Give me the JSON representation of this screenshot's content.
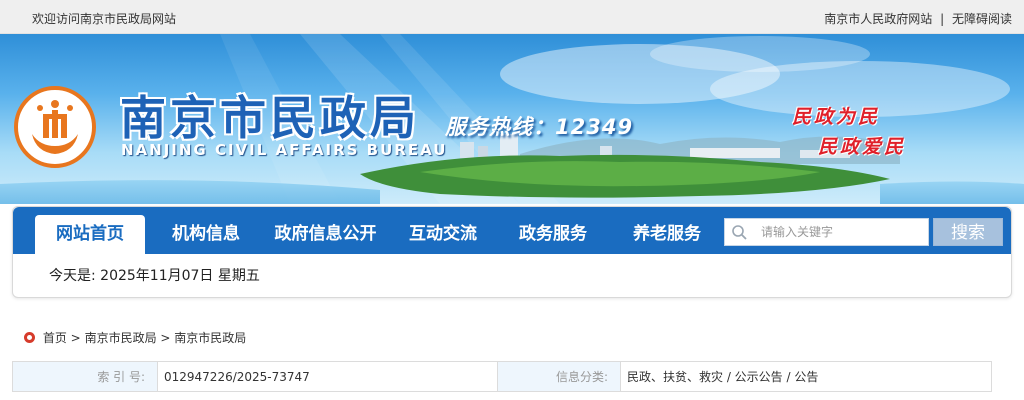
{
  "topbar": {
    "welcome": "欢迎访问南京市民政局网站",
    "links": [
      "南京市人民政府网站",
      "无障碍阅读"
    ],
    "separator": "|"
  },
  "banner": {
    "title_cn": "南京市民政局",
    "title_en": "NANJING CIVIL AFFAIRS BUREAU",
    "hotline": "服务热线：12349",
    "slogans": [
      "民政为民",
      "民政爱民"
    ]
  },
  "nav": {
    "items": [
      "网站首页",
      "机构信息",
      "政府信息公开",
      "互动交流",
      "政务服务",
      "养老服务"
    ],
    "active_index": 0,
    "search_placeholder": "请输入关键字",
    "search_button": "搜索",
    "date_text": "今天是: 2025年11月07日 星期五"
  },
  "breadcrumb": [
    "首页",
    "南京市民政局",
    "南京市民政局"
  ],
  "breadcrumb_separator": ">",
  "info": {
    "index_label": "索 引 号:",
    "index_value": "012947226/2025-73747",
    "category_label": "信息分类:",
    "category_value": "民政、扶贫、救灾 / 公示公告 / 公告"
  },
  "colors": {
    "nav_blue": "#1a6cc0",
    "logo_orange": "#e8761e",
    "slogan_red": "#e0202a",
    "title_blue": "#1e62b6"
  }
}
